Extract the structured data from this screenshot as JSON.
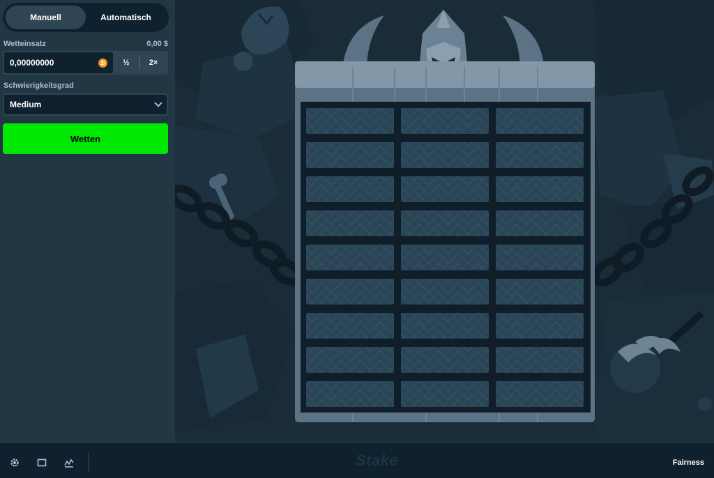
{
  "sidebar": {
    "modes": {
      "manual": "Manuell",
      "auto": "Automatisch"
    },
    "bet_amount_label": "Wetteinsatz",
    "bet_amount_usd": "0,00 $",
    "bet_amount_value": "0,00000000",
    "currency_icon": "bitcoin-icon",
    "half_label": "½",
    "double_label": "2×",
    "difficulty_label": "Schwierigkeitsgrad",
    "difficulty_value": "Medium",
    "bet_button": "Wetten"
  },
  "game": {
    "grid": {
      "rows": 9,
      "columns": 3
    }
  },
  "footer": {
    "brand": "Stake",
    "fairness": "Fairness",
    "icons": [
      "gear-icon",
      "theatre-icon",
      "stats-icon"
    ]
  },
  "colors": {
    "accent_green": "#00e701",
    "sidebar_bg": "#213743",
    "game_bg": "#1a2c38",
    "tile": "#2a4556"
  }
}
